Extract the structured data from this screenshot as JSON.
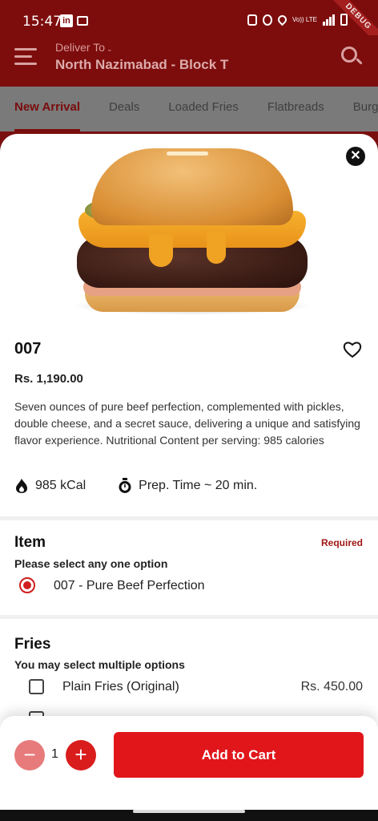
{
  "status_bar": {
    "time": "15:47",
    "debug_label": "DEBUG",
    "volte": "Vo)) LTE"
  },
  "header": {
    "deliver_label": "Deliver To",
    "address": "North Nazimabad - Block T"
  },
  "tabs": [
    {
      "label": "New Arrival",
      "active": true
    },
    {
      "label": "Deals"
    },
    {
      "label": "Loaded Fries"
    },
    {
      "label": "Flatbreads"
    },
    {
      "label": "Burg"
    }
  ],
  "product": {
    "name": "007",
    "price": "Rs. 1,190.00",
    "description": "Seven ounces of pure beef perfection, complemented with pickles, double cheese, and a secret sauce, delivering a unique and satisfying flavor experience. Nutritional Content per serving: 985 calories",
    "calories": "985 kCal",
    "prep_time": "Prep. Time ~ 20 min."
  },
  "item_section": {
    "title": "Item",
    "required": "Required",
    "subtitle": "Please select any one option",
    "options": [
      {
        "label": "007 - Pure Beef Perfection",
        "selected": true
      }
    ]
  },
  "fries_section": {
    "title": "Fries",
    "subtitle": "You may select multiple options",
    "options": [
      {
        "label": "Plain Fries (Original)",
        "price": "Rs. 450.00",
        "checked": false
      }
    ]
  },
  "cart": {
    "quantity": "1",
    "minus": "−",
    "plus": "+",
    "add_label": "Add to Cart"
  },
  "colors": {
    "brand": "#7d0d0d",
    "accent": "#e0161b",
    "radio": "#d11d1d"
  },
  "icons": {
    "close": "close-icon",
    "favorite": "heart-icon",
    "calories": "flame-icon",
    "prep": "timer-icon",
    "menu": "menu-icon",
    "search": "search-icon"
  }
}
